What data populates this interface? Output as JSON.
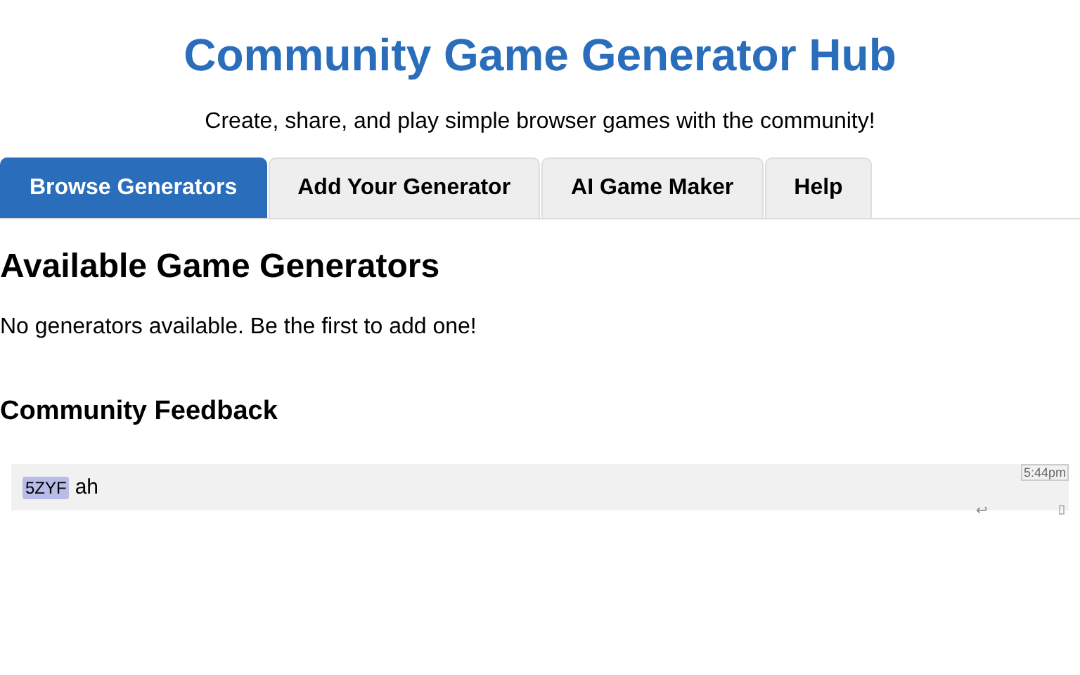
{
  "header": {
    "title": "Community Game Generator Hub",
    "subtitle": "Create, share, and play simple browser games with the community!"
  },
  "tabs": [
    {
      "label": "Browse Generators",
      "selected": true
    },
    {
      "label": "Add Your Generator",
      "selected": false
    },
    {
      "label": "AI Game Maker",
      "selected": false
    },
    {
      "label": "Help",
      "selected": false
    }
  ],
  "generators": {
    "heading": "Available Game Generators",
    "empty_message": "No generators available. Be the first to add one!"
  },
  "feedback": {
    "heading": "Community Feedback",
    "messages": [
      {
        "user": "5ZYF",
        "text": "ah",
        "time": "5:44pm",
        "reply_icon": "↩"
      }
    ]
  }
}
